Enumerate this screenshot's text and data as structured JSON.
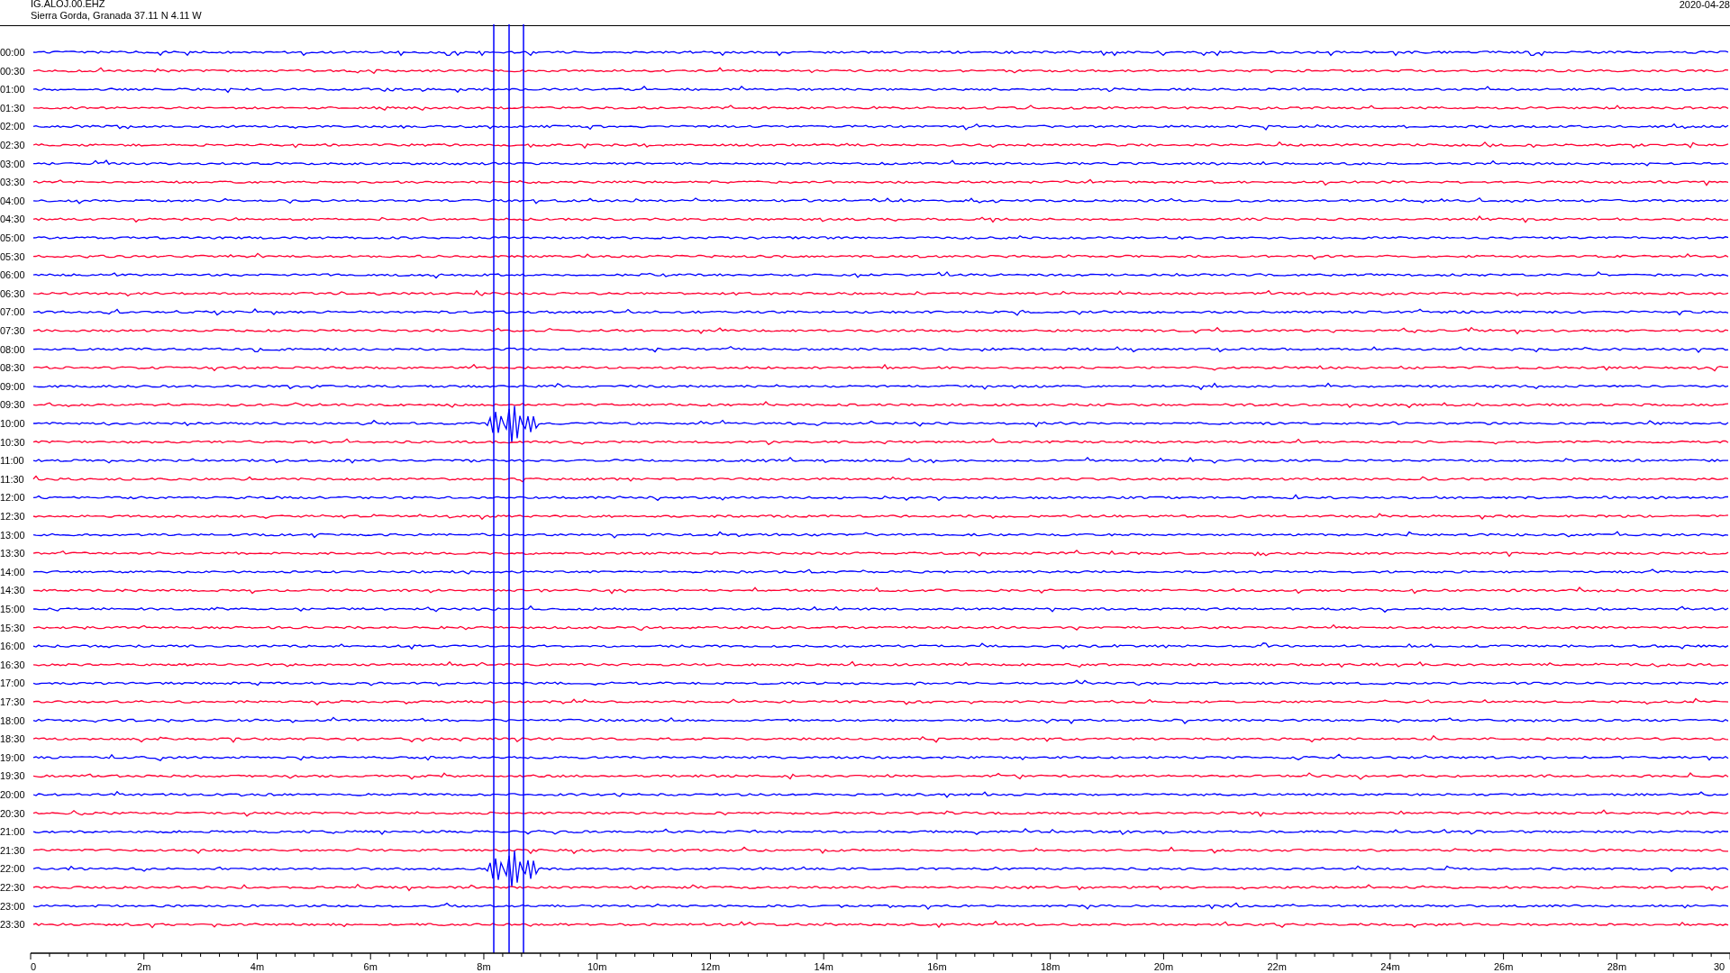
{
  "header": {
    "station": "IG.ALOJ.00.EHZ",
    "location": "Sierra Gorda, Granada  37.11 N 4.11 W",
    "date": "2020-04-28"
  },
  "traces": [
    {
      "label": "00:00",
      "color": "#0000ff"
    },
    {
      "label": "00:30",
      "color": "#ff0033"
    },
    {
      "label": "01:00",
      "color": "#0000ff"
    },
    {
      "label": "01:30",
      "color": "#ff0033"
    },
    {
      "label": "02:00",
      "color": "#0000ff"
    },
    {
      "label": "02:30",
      "color": "#ff0033"
    },
    {
      "label": "03:00",
      "color": "#0000ff"
    },
    {
      "label": "03:30",
      "color": "#ff0033"
    },
    {
      "label": "04:00",
      "color": "#0000ff"
    },
    {
      "label": "04:30",
      "color": "#ff0033"
    },
    {
      "label": "05:00",
      "color": "#0000ff"
    },
    {
      "label": "05:30",
      "color": "#ff0033"
    },
    {
      "label": "06:00",
      "color": "#0000ff"
    },
    {
      "label": "06:30",
      "color": "#ff0033"
    },
    {
      "label": "07:00",
      "color": "#0000ff"
    },
    {
      "label": "07:30",
      "color": "#ff0033"
    },
    {
      "label": "08:00",
      "color": "#0000ff"
    },
    {
      "label": "08:30",
      "color": "#ff0033"
    },
    {
      "label": "09:00",
      "color": "#0000ff"
    },
    {
      "label": "09:30",
      "color": "#ff0033"
    },
    {
      "label": "10:00",
      "color": "#0000ff"
    },
    {
      "label": "10:30",
      "color": "#ff0033"
    },
    {
      "label": "11:00",
      "color": "#0000ff"
    },
    {
      "label": "11:30",
      "color": "#ff0033"
    },
    {
      "label": "12:00",
      "color": "#0000ff"
    },
    {
      "label": "12:30",
      "color": "#ff0033"
    },
    {
      "label": "13:00",
      "color": "#0000ff"
    },
    {
      "label": "13:30",
      "color": "#ff0033"
    },
    {
      "label": "14:00",
      "color": "#0000ff"
    },
    {
      "label": "14:30",
      "color": "#ff0033"
    },
    {
      "label": "15:00",
      "color": "#0000ff"
    },
    {
      "label": "15:30",
      "color": "#ff0033"
    },
    {
      "label": "16:00",
      "color": "#0000ff"
    },
    {
      "label": "16:30",
      "color": "#ff0033"
    },
    {
      "label": "17:00",
      "color": "#0000ff"
    },
    {
      "label": "17:30",
      "color": "#ff0033"
    },
    {
      "label": "18:00",
      "color": "#0000ff"
    },
    {
      "label": "18:30",
      "color": "#ff0033"
    },
    {
      "label": "19:00",
      "color": "#0000ff"
    },
    {
      "label": "19:30",
      "color": "#ff0033"
    },
    {
      "label": "20:00",
      "color": "#0000ff"
    },
    {
      "label": "20:30",
      "color": "#ff0033"
    },
    {
      "label": "21:00",
      "color": "#0000ff"
    },
    {
      "label": "21:30",
      "color": "#ff0033"
    },
    {
      "label": "22:00",
      "color": "#0000ff"
    },
    {
      "label": "22:30",
      "color": "#ff0033"
    },
    {
      "label": "23:00",
      "color": "#0000ff"
    },
    {
      "label": "23:30",
      "color": "#ff0033"
    }
  ],
  "x_axis": {
    "labels": [
      "0",
      "2m",
      "4m",
      "6m",
      "8m",
      "10m",
      "12m",
      "14m",
      "16m",
      "18m",
      "20m",
      "22m",
      "24m",
      "26m",
      "28m",
      "30"
    ]
  }
}
